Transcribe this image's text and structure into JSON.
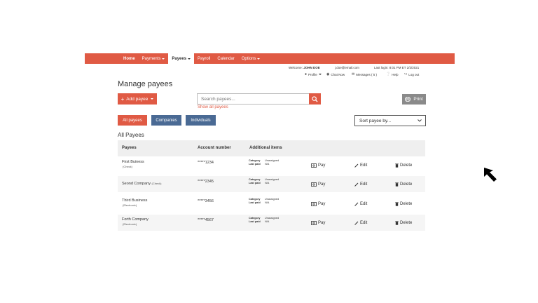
{
  "nav": {
    "items": [
      {
        "label": "Home",
        "caret": false,
        "bold": true,
        "active": false
      },
      {
        "label": "Payments",
        "caret": true,
        "bold": false,
        "active": false
      },
      {
        "label": "Payees",
        "caret": true,
        "bold": true,
        "active": true
      },
      {
        "label": "Payroll",
        "caret": false,
        "bold": false,
        "active": false
      },
      {
        "label": "Calendar",
        "caret": false,
        "bold": false,
        "active": false
      },
      {
        "label": "Options",
        "caret": true,
        "bold": false,
        "active": false
      }
    ]
  },
  "header_info": {
    "welcome_prefix": "Welcome:",
    "user_name": "JOHN DOE",
    "email": "j.doe@email.com",
    "last_login": "Last login: 8:01 PM ET 2/2/2021"
  },
  "utility": {
    "profile": "Profile",
    "chat": "Chat Now",
    "messages": "Messages ( 5 )",
    "help": "Help",
    "logout": "Log out"
  },
  "page": {
    "title": "Manage payees",
    "add_button": "Add payee",
    "search_placeholder": "Search payees...",
    "show_all": "Show all payees",
    "print": "Print",
    "filters": [
      "All payees",
      "Companies",
      "Individuals"
    ],
    "sort_label": "Sort payee by...",
    "section_title": "All Payees"
  },
  "table": {
    "headers": [
      "Payees",
      "Account number",
      "Additional items"
    ],
    "cat_label": "Category",
    "paid_label": "Last paid",
    "actions": {
      "pay": "Pay",
      "edit": "Edit",
      "delete": "Delete"
    },
    "rows": [
      {
        "name": "First Buiness",
        "type": "(Check)",
        "account": "*****1234",
        "category": "Unassigned",
        "last_paid": "N/A"
      },
      {
        "name": "Seond Company",
        "type": "(Check)",
        "account": "*****2345",
        "category": "Unassigned",
        "last_paid": "N/A"
      },
      {
        "name": "Third Business",
        "type": "(Electronic)",
        "account": "*****3456",
        "category": "Unassigned",
        "last_paid": "N/A"
      },
      {
        "name": "Forth Company",
        "type": "(Electronic)",
        "account": "*****4567",
        "category": "Unassigned",
        "last_paid": "N/A"
      }
    ]
  },
  "colors": {
    "accent": "#e05a44",
    "secondary": "#4a6a94",
    "print_gray": "#8a8a8a"
  }
}
